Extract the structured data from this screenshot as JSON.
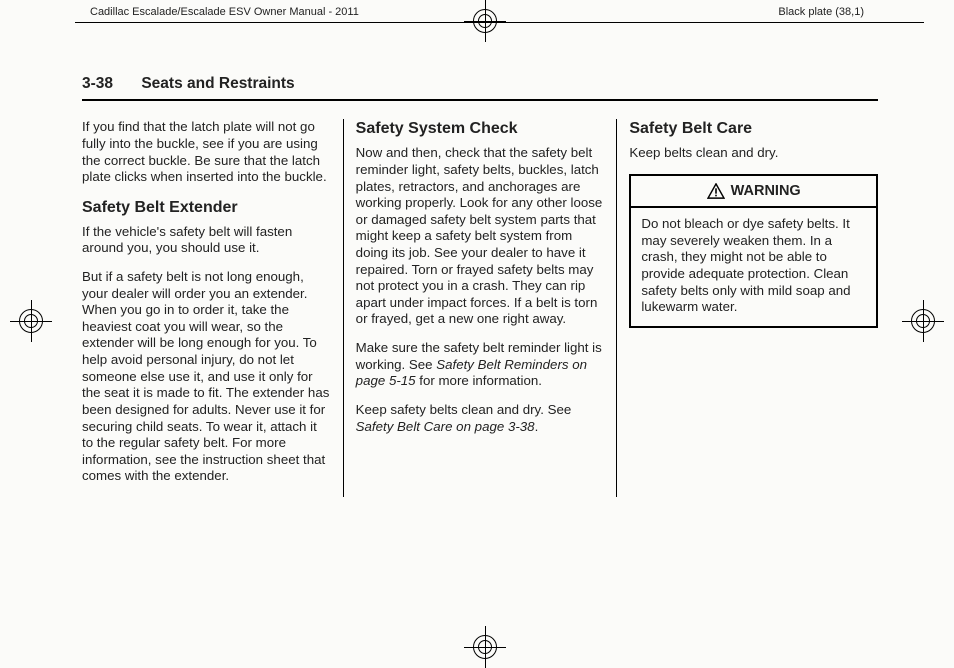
{
  "meta": {
    "manual_title": "Cadillac Escalade/Escalade ESV Owner Manual - 2011",
    "plate": "Black plate (38,1)"
  },
  "header": {
    "page_num": "3-38",
    "section": "Seats and Restraints"
  },
  "col1": {
    "p1": "If you find that the latch plate will not go fully into the buckle, see if you are using the correct buckle. Be sure that the latch plate clicks when inserted into the buckle.",
    "h1": "Safety Belt Extender",
    "p2": "If the vehicle's safety belt will fasten around you, you should use it.",
    "p3": "But if a safety belt is not long enough, your dealer will order you an extender. When you go in to order it, take the heaviest coat you will wear, so the extender will be long enough for you. To help avoid personal injury, do not let someone else use it, and use it only for the seat it is made to fit. The extender has been designed for adults. Never use it for securing child seats. To wear it, attach it to the regular safety belt. For more information, see the instruction sheet that comes with the extender."
  },
  "col2": {
    "h1": "Safety System Check",
    "p1": "Now and then, check that the safety belt reminder light, safety belts, buckles, latch plates, retractors, and anchorages are working properly. Look for any other loose or damaged safety belt system parts that might keep a safety belt system from doing its job. See your dealer to have it repaired. Torn or frayed safety belts may not protect you in a crash. They can rip apart under impact forces. If a belt is torn or frayed, get a new one right away.",
    "p2a": "Make sure the safety belt reminder light is working. See ",
    "p2ref": "Safety Belt Reminders on page 5‑15",
    "p2b": " for more information.",
    "p3a": "Keep safety belts clean and dry. See ",
    "p3ref": "Safety Belt Care on page 3‑38",
    "p3b": "."
  },
  "col3": {
    "h1": "Safety Belt Care",
    "p1": "Keep belts clean and dry.",
    "warn_title": "WARNING",
    "warn_body": "Do not bleach or dye safety belts. It may severely weaken them. In a crash, they might not be able to provide adequate protection. Clean safety belts only with mild soap and lukewarm water."
  }
}
